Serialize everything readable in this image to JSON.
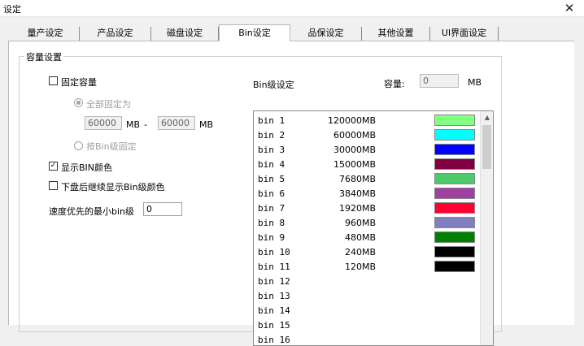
{
  "window": {
    "title": "设定",
    "close_glyph": "✕"
  },
  "tabs": [
    {
      "label": "量产设定"
    },
    {
      "label": "产品设定"
    },
    {
      "label": "磁盘设定"
    },
    {
      "label": "Bin设定",
      "active": true
    },
    {
      "label": "品保设定"
    },
    {
      "label": "其他设置"
    },
    {
      "label": "UI界面设定"
    }
  ],
  "capacity_group": {
    "title": "容量设置",
    "fixed_capacity": {
      "label": "固定容量",
      "checked": false
    },
    "all_fixed": {
      "label": "全部固定为",
      "checked": true
    },
    "min_value": "60000",
    "unit1": "MB",
    "dash": "-",
    "max_value": "60000",
    "unit2": "MB",
    "by_bin": {
      "label": "按Bin级固定",
      "checked": false
    },
    "show_bin_color": {
      "label": "显示BIN颜色",
      "checked": true
    },
    "continue_after_eject": {
      "label": "下盘后继续显示Bin级颜色",
      "checked": false
    },
    "min_bin_label": "速度优先的最小bin级",
    "min_bin_value": "0"
  },
  "bin_settings": {
    "label": "Bin级设定",
    "capacity_label": "容量:",
    "capacity_value": "0",
    "capacity_unit": "MB",
    "rows": [
      {
        "name": "bin 1",
        "size": "120000MB",
        "color": "#80ff80"
      },
      {
        "name": "bin 2",
        "size": "60000MB",
        "color": "#00ffff"
      },
      {
        "name": "bin 3",
        "size": "30000MB",
        "color": "#0000ff"
      },
      {
        "name": "bin 4",
        "size": "15000MB",
        "color": "#800040"
      },
      {
        "name": "bin 5",
        "size": "7680MB",
        "color": "#4cc96a"
      },
      {
        "name": "bin 6",
        "size": "3840MB",
        "color": "#a040a0"
      },
      {
        "name": "bin 7",
        "size": "1920MB",
        "color": "#ff0030"
      },
      {
        "name": "bin 8",
        "size": "960MB",
        "color": "#8080c0"
      },
      {
        "name": "bin 9",
        "size": "480MB",
        "color": "#008000"
      },
      {
        "name": "bin 10",
        "size": "240MB",
        "color": "#000000"
      },
      {
        "name": "bin 11",
        "size": "120MB",
        "color": "#000000"
      },
      {
        "name": "bin 12",
        "size": "",
        "color": ""
      },
      {
        "name": "bin 13",
        "size": "",
        "color": ""
      },
      {
        "name": "bin 14",
        "size": "",
        "color": ""
      },
      {
        "name": "bin 15",
        "size": "",
        "color": ""
      },
      {
        "name": "bin 16",
        "size": "",
        "color": ""
      }
    ],
    "scroll_up_glyph": "▲"
  },
  "checkmark": "✓"
}
